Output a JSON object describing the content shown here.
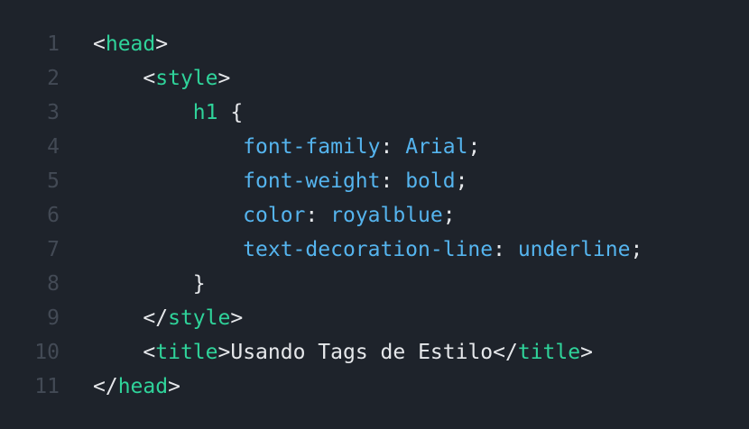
{
  "lines": [
    {
      "number": "1",
      "tokens": [
        {
          "t": "<",
          "k": "punc"
        },
        {
          "t": "head",
          "k": "tag"
        },
        {
          "t": ">",
          "k": "punc"
        }
      ]
    },
    {
      "number": "2",
      "tokens": [
        {
          "t": "    ",
          "k": "text"
        },
        {
          "t": "<",
          "k": "punc"
        },
        {
          "t": "style",
          "k": "tag"
        },
        {
          "t": ">",
          "k": "punc"
        }
      ]
    },
    {
      "number": "3",
      "tokens": [
        {
          "t": "        ",
          "k": "text"
        },
        {
          "t": "h1",
          "k": "sel"
        },
        {
          "t": " {",
          "k": "punc"
        }
      ]
    },
    {
      "number": "4",
      "tokens": [
        {
          "t": "            ",
          "k": "text"
        },
        {
          "t": "font-family",
          "k": "prop"
        },
        {
          "t": ": ",
          "k": "punc"
        },
        {
          "t": "Arial",
          "k": "val"
        },
        {
          "t": ";",
          "k": "punc"
        }
      ]
    },
    {
      "number": "5",
      "tokens": [
        {
          "t": "            ",
          "k": "text"
        },
        {
          "t": "font-weight",
          "k": "prop"
        },
        {
          "t": ": ",
          "k": "punc"
        },
        {
          "t": "bold",
          "k": "val"
        },
        {
          "t": ";",
          "k": "punc"
        }
      ]
    },
    {
      "number": "6",
      "tokens": [
        {
          "t": "            ",
          "k": "text"
        },
        {
          "t": "color",
          "k": "prop"
        },
        {
          "t": ": ",
          "k": "punc"
        },
        {
          "t": "royalblue",
          "k": "val"
        },
        {
          "t": ";",
          "k": "punc"
        }
      ]
    },
    {
      "number": "7",
      "tokens": [
        {
          "t": "            ",
          "k": "text"
        },
        {
          "t": "text-decoration-line",
          "k": "prop"
        },
        {
          "t": ": ",
          "k": "punc"
        },
        {
          "t": "underline",
          "k": "val"
        },
        {
          "t": ";",
          "k": "punc"
        }
      ]
    },
    {
      "number": "8",
      "tokens": [
        {
          "t": "        ",
          "k": "text"
        },
        {
          "t": "}",
          "k": "punc"
        }
      ]
    },
    {
      "number": "9",
      "tokens": [
        {
          "t": "    ",
          "k": "text"
        },
        {
          "t": "</",
          "k": "punc"
        },
        {
          "t": "style",
          "k": "tag"
        },
        {
          "t": ">",
          "k": "punc"
        }
      ]
    },
    {
      "number": "10",
      "tokens": [
        {
          "t": "    ",
          "k": "text"
        },
        {
          "t": "<",
          "k": "punc"
        },
        {
          "t": "title",
          "k": "tag"
        },
        {
          "t": ">",
          "k": "punc"
        },
        {
          "t": "Usando Tags de Estilo",
          "k": "text"
        },
        {
          "t": "</",
          "k": "punc"
        },
        {
          "t": "title",
          "k": "tag"
        },
        {
          "t": ">",
          "k": "punc"
        }
      ]
    },
    {
      "number": "11",
      "tokens": [
        {
          "t": "</",
          "k": "punc"
        },
        {
          "t": "head",
          "k": "tag"
        },
        {
          "t": ">",
          "k": "punc"
        }
      ]
    }
  ],
  "colors": {
    "background": "#1e232b",
    "line_number": "#434a55",
    "tag": "#2fd39a",
    "property": "#55b4ee",
    "text": "#e6e8eb"
  }
}
